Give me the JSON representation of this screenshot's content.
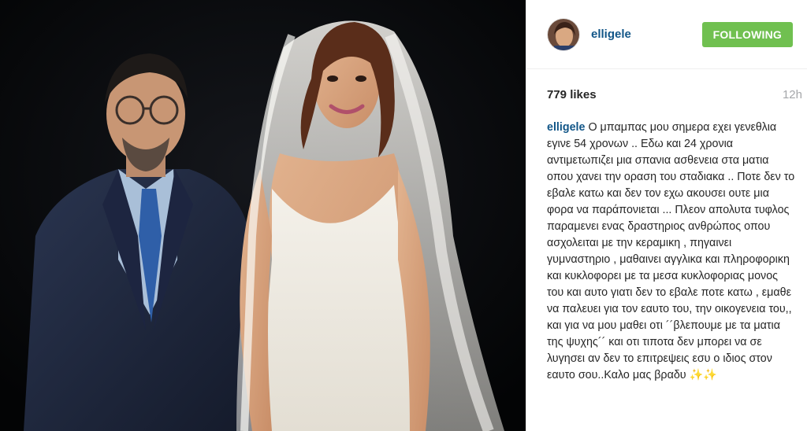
{
  "post": {
    "username": "elligele",
    "follow_label": "FOLLOWING",
    "likes": "779 likes",
    "time": "12h",
    "caption_user": "elligele",
    "caption_text": "Ο μπαμπας μου σημερα εχει γενεθλια εγινε 54 χρονων .. Εδω και 24 χρονια αντιμετωπιζει μια σπανια ασθενεια στα ματια οπου χανει την οραση του σταδιακα .. Ποτε δεν το εβαλε κατω και δεν τον εχω ακουσει ουτε μια φορα να παράπονιεται ... Πλεον απολυτα τυφλος παραμενει ενας δραστηριος ανθρώπος οπου ασχολειται με την κεραμικη , πηγαινει γυμναστηριο , μαθαινει αγγλικα και πληροφορικη και κυκλοφορει με τα μεσα κυκλοφοριας μονος του και αυτο γιατι δεν το εβαλε ποτε κατω , εμαθε να παλευει για τον εαυτο του, την οικογενεια του,, και για να μου μαθει οτι ´´βλεπουμε με τα ματια της ψυχης´´ και οτι τιποτα δεν μπορει να σε λυγησει αν δεν το επιτρεψεις εσυ ο ιδιος στον εαυτο σου..Καλο μας βραδυ ✨✨"
  },
  "colors": {
    "username": "#125688",
    "follow_button": "#70c050",
    "time": "#a5a7aa",
    "photo_background": "#050608"
  },
  "icons": {
    "avatar": "profile-photo-woman"
  }
}
